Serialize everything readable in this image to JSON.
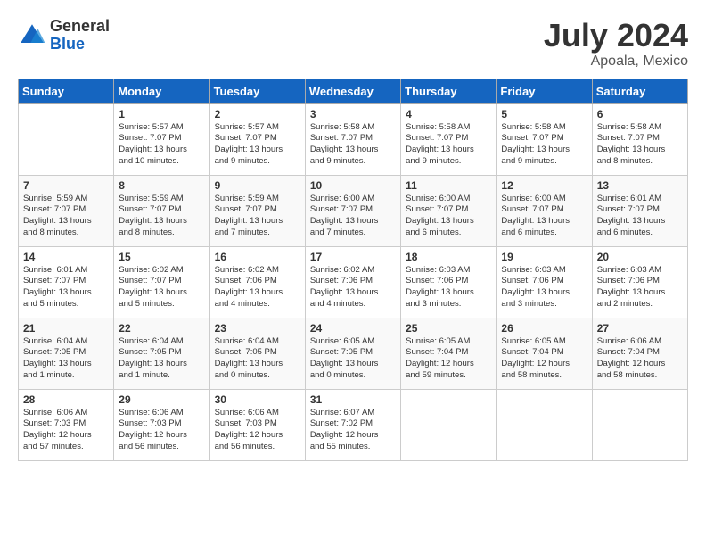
{
  "header": {
    "logo_general": "General",
    "logo_blue": "Blue",
    "month_year": "July 2024",
    "location": "Apoala, Mexico"
  },
  "days_of_week": [
    "Sunday",
    "Monday",
    "Tuesday",
    "Wednesday",
    "Thursday",
    "Friday",
    "Saturday"
  ],
  "weeks": [
    [
      {
        "date": "",
        "info": ""
      },
      {
        "date": "1",
        "info": "Sunrise: 5:57 AM\nSunset: 7:07 PM\nDaylight: 13 hours\nand 10 minutes."
      },
      {
        "date": "2",
        "info": "Sunrise: 5:57 AM\nSunset: 7:07 PM\nDaylight: 13 hours\nand 9 minutes."
      },
      {
        "date": "3",
        "info": "Sunrise: 5:58 AM\nSunset: 7:07 PM\nDaylight: 13 hours\nand 9 minutes."
      },
      {
        "date": "4",
        "info": "Sunrise: 5:58 AM\nSunset: 7:07 PM\nDaylight: 13 hours\nand 9 minutes."
      },
      {
        "date": "5",
        "info": "Sunrise: 5:58 AM\nSunset: 7:07 PM\nDaylight: 13 hours\nand 9 minutes."
      },
      {
        "date": "6",
        "info": "Sunrise: 5:58 AM\nSunset: 7:07 PM\nDaylight: 13 hours\nand 8 minutes."
      }
    ],
    [
      {
        "date": "7",
        "info": "Sunrise: 5:59 AM\nSunset: 7:07 PM\nDaylight: 13 hours\nand 8 minutes."
      },
      {
        "date": "8",
        "info": "Sunrise: 5:59 AM\nSunset: 7:07 PM\nDaylight: 13 hours\nand 8 minutes."
      },
      {
        "date": "9",
        "info": "Sunrise: 5:59 AM\nSunset: 7:07 PM\nDaylight: 13 hours\nand 7 minutes."
      },
      {
        "date": "10",
        "info": "Sunrise: 6:00 AM\nSunset: 7:07 PM\nDaylight: 13 hours\nand 7 minutes."
      },
      {
        "date": "11",
        "info": "Sunrise: 6:00 AM\nSunset: 7:07 PM\nDaylight: 13 hours\nand 6 minutes."
      },
      {
        "date": "12",
        "info": "Sunrise: 6:00 AM\nSunset: 7:07 PM\nDaylight: 13 hours\nand 6 minutes."
      },
      {
        "date": "13",
        "info": "Sunrise: 6:01 AM\nSunset: 7:07 PM\nDaylight: 13 hours\nand 6 minutes."
      }
    ],
    [
      {
        "date": "14",
        "info": "Sunrise: 6:01 AM\nSunset: 7:07 PM\nDaylight: 13 hours\nand 5 minutes."
      },
      {
        "date": "15",
        "info": "Sunrise: 6:02 AM\nSunset: 7:07 PM\nDaylight: 13 hours\nand 5 minutes."
      },
      {
        "date": "16",
        "info": "Sunrise: 6:02 AM\nSunset: 7:06 PM\nDaylight: 13 hours\nand 4 minutes."
      },
      {
        "date": "17",
        "info": "Sunrise: 6:02 AM\nSunset: 7:06 PM\nDaylight: 13 hours\nand 4 minutes."
      },
      {
        "date": "18",
        "info": "Sunrise: 6:03 AM\nSunset: 7:06 PM\nDaylight: 13 hours\nand 3 minutes."
      },
      {
        "date": "19",
        "info": "Sunrise: 6:03 AM\nSunset: 7:06 PM\nDaylight: 13 hours\nand 3 minutes."
      },
      {
        "date": "20",
        "info": "Sunrise: 6:03 AM\nSunset: 7:06 PM\nDaylight: 13 hours\nand 2 minutes."
      }
    ],
    [
      {
        "date": "21",
        "info": "Sunrise: 6:04 AM\nSunset: 7:05 PM\nDaylight: 13 hours\nand 1 minute."
      },
      {
        "date": "22",
        "info": "Sunrise: 6:04 AM\nSunset: 7:05 PM\nDaylight: 13 hours\nand 1 minute."
      },
      {
        "date": "23",
        "info": "Sunrise: 6:04 AM\nSunset: 7:05 PM\nDaylight: 13 hours\nand 0 minutes."
      },
      {
        "date": "24",
        "info": "Sunrise: 6:05 AM\nSunset: 7:05 PM\nDaylight: 13 hours\nand 0 minutes."
      },
      {
        "date": "25",
        "info": "Sunrise: 6:05 AM\nSunset: 7:04 PM\nDaylight: 12 hours\nand 59 minutes."
      },
      {
        "date": "26",
        "info": "Sunrise: 6:05 AM\nSunset: 7:04 PM\nDaylight: 12 hours\nand 58 minutes."
      },
      {
        "date": "27",
        "info": "Sunrise: 6:06 AM\nSunset: 7:04 PM\nDaylight: 12 hours\nand 58 minutes."
      }
    ],
    [
      {
        "date": "28",
        "info": "Sunrise: 6:06 AM\nSunset: 7:03 PM\nDaylight: 12 hours\nand 57 minutes."
      },
      {
        "date": "29",
        "info": "Sunrise: 6:06 AM\nSunset: 7:03 PM\nDaylight: 12 hours\nand 56 minutes."
      },
      {
        "date": "30",
        "info": "Sunrise: 6:06 AM\nSunset: 7:03 PM\nDaylight: 12 hours\nand 56 minutes."
      },
      {
        "date": "31",
        "info": "Sunrise: 6:07 AM\nSunset: 7:02 PM\nDaylight: 12 hours\nand 55 minutes."
      },
      {
        "date": "",
        "info": ""
      },
      {
        "date": "",
        "info": ""
      },
      {
        "date": "",
        "info": ""
      }
    ]
  ]
}
